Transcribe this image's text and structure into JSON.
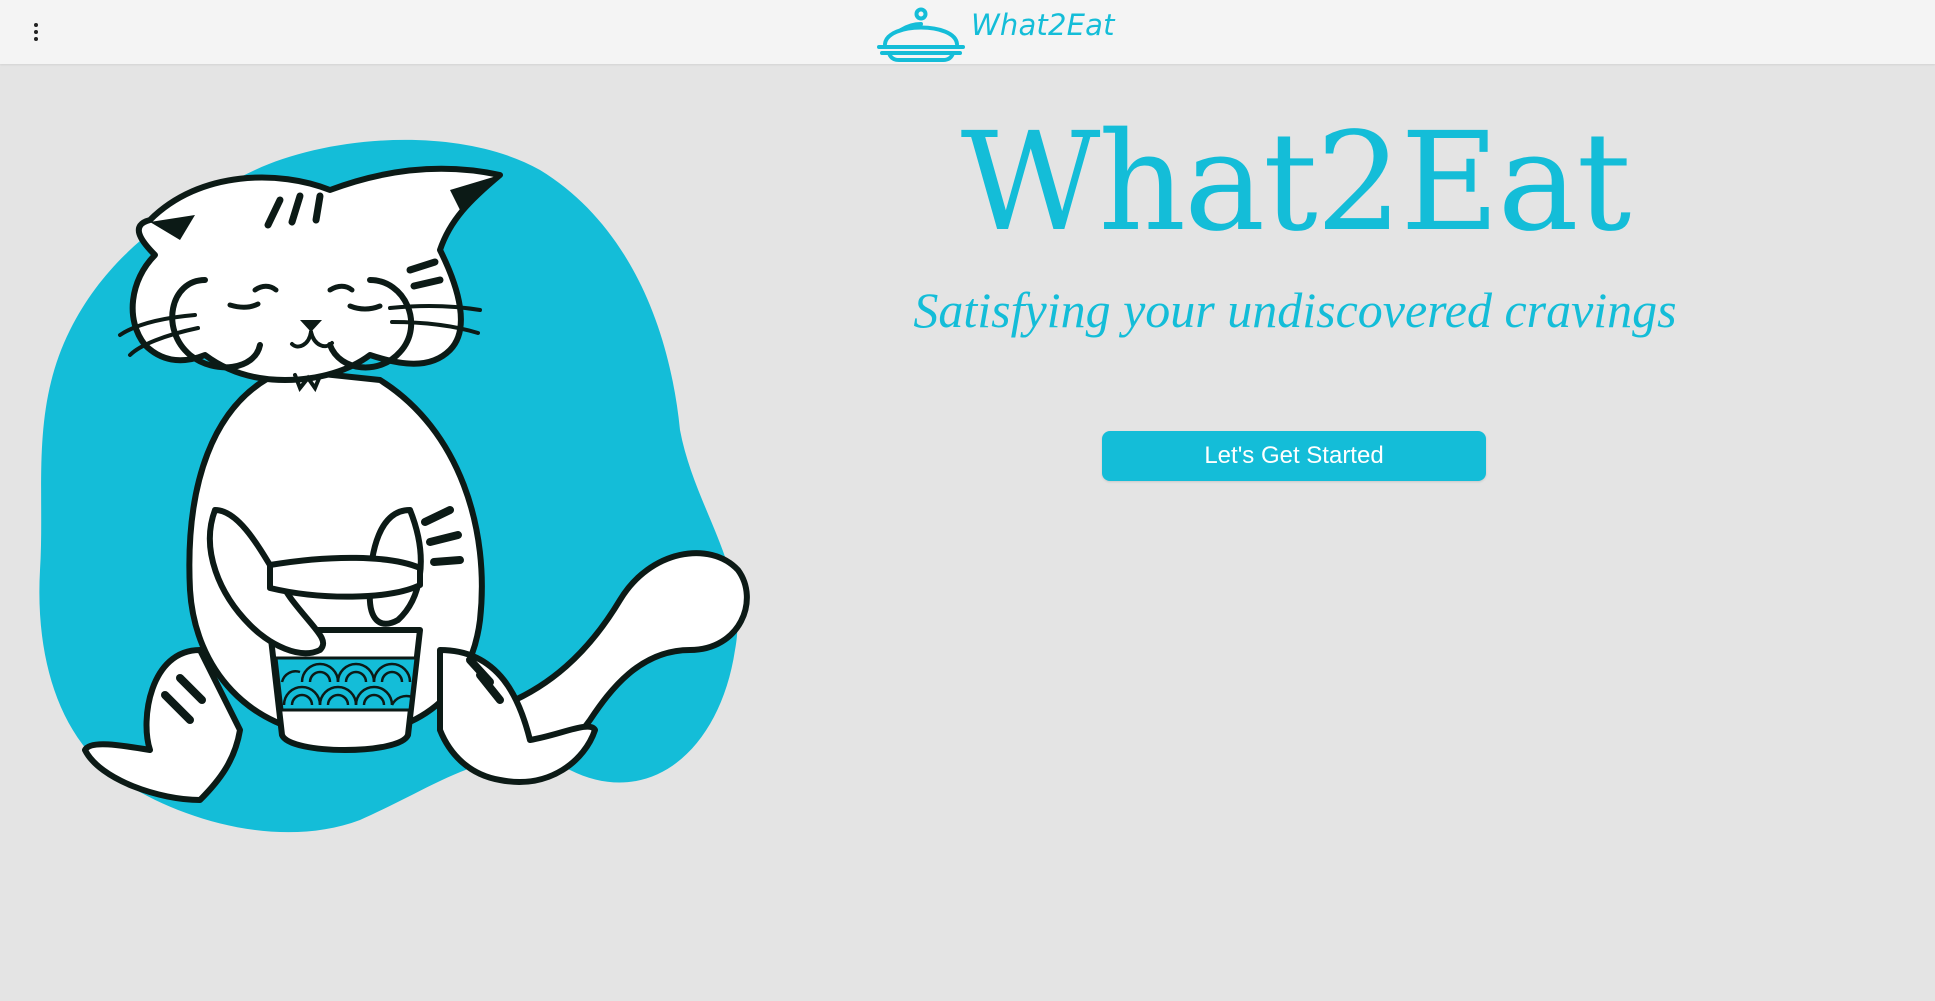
{
  "header": {
    "menu_icon": "more-vertical-icon",
    "logo_icon": "cloche-icon",
    "brand_name": "What2Eat"
  },
  "hero": {
    "title": "What2Eat",
    "subtitle": "Satisfying your undiscovered cravings",
    "cta_label": "Let's Get Started",
    "illustration": "cat-eating-noodles-illustration"
  },
  "colors": {
    "accent": "#14bdd8",
    "background": "#e4e4e4",
    "header_background": "#f4f4f4",
    "button_text": "#ffffff",
    "outline": "#0c1a16"
  }
}
